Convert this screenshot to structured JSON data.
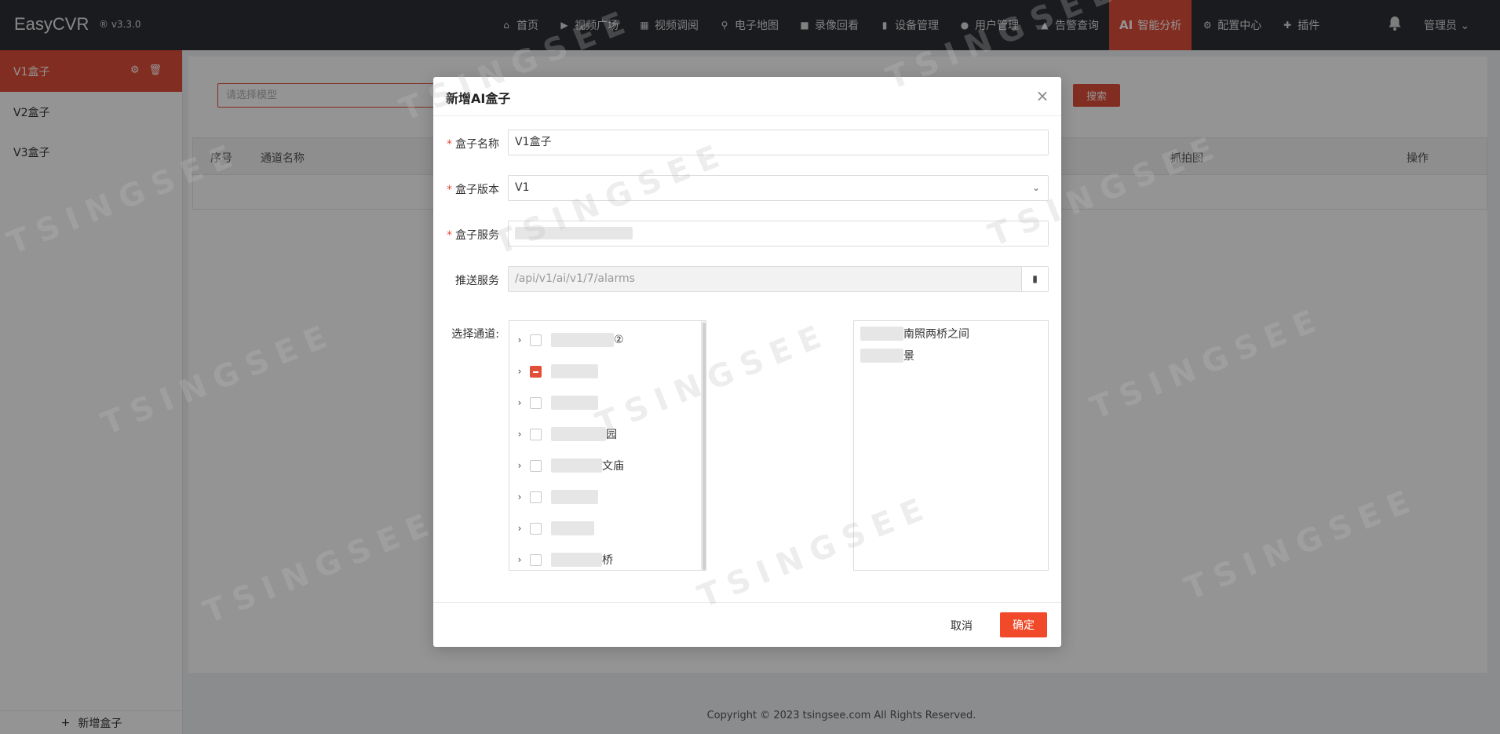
{
  "app": {
    "brand": "EasyCVR",
    "version": "® v3.3.0"
  },
  "nav": {
    "items": [
      {
        "icon": "home-icon",
        "label": "首页"
      },
      {
        "icon": "play-icon",
        "label": "视频广场"
      },
      {
        "icon": "grid-icon",
        "label": "视频调阅"
      },
      {
        "icon": "map-pin-icon",
        "label": "电子地图"
      },
      {
        "icon": "video-camera-icon",
        "label": "录像回看"
      },
      {
        "icon": "device-icon",
        "label": "设备管理"
      },
      {
        "icon": "user-icon",
        "label": "用户管理"
      },
      {
        "icon": "alarm-icon",
        "label": "告警查询"
      },
      {
        "icon": "ai-icon",
        "label": "智能分析",
        "prefix": "AI",
        "active": true
      },
      {
        "icon": "gear-icon",
        "label": "配置中心"
      },
      {
        "icon": "puzzle-icon",
        "label": "插件"
      }
    ],
    "user": "管理员"
  },
  "sidebar": {
    "items": [
      {
        "label": "V1盒子",
        "active": true
      },
      {
        "label": "V2盒子"
      },
      {
        "label": "V3盒子"
      }
    ],
    "add_label": "新增盒子"
  },
  "main": {
    "search_placeholder": "请选择模型",
    "search_button": "搜索",
    "columns": [
      "序号",
      "通道名称",
      "抓拍图",
      "操作"
    ]
  },
  "footer": {
    "copyright": "Copyright © 2023 tsingsee.com All Rights Reserved."
  },
  "modal": {
    "title": "新增AI盒子",
    "fields": {
      "name": {
        "label": "盒子名称",
        "value": "V1盒子"
      },
      "version": {
        "label": "盒子版本",
        "value": "V1"
      },
      "service": {
        "label": "盒子服务",
        "value": ""
      },
      "push": {
        "label": "推送服务",
        "value": "/api/v1/ai/v1/7/alarms"
      }
    },
    "channel_label": "选择通道:",
    "tree": [
      {
        "visible_suffix": "②",
        "state": "unchecked"
      },
      {
        "visible_suffix": "",
        "state": "indeterminate"
      },
      {
        "visible_suffix": "",
        "state": "unchecked"
      },
      {
        "visible_suffix": "园",
        "state": "unchecked"
      },
      {
        "visible_suffix": "文庙",
        "state": "unchecked"
      },
      {
        "visible_suffix": "",
        "state": "unchecked"
      },
      {
        "visible_suffix": "",
        "state": "unchecked"
      },
      {
        "visible_suffix": "桥",
        "state": "unchecked"
      }
    ],
    "selected": [
      {
        "visible_suffix": "南照两桥之间"
      },
      {
        "visible_suffix": "景"
      }
    ],
    "cancel": "取消",
    "ok": "确定"
  },
  "watermark": "TSINGSEE青犀视频",
  "colors": {
    "accent": "#e14f39",
    "topbar": "#2d3035"
  }
}
